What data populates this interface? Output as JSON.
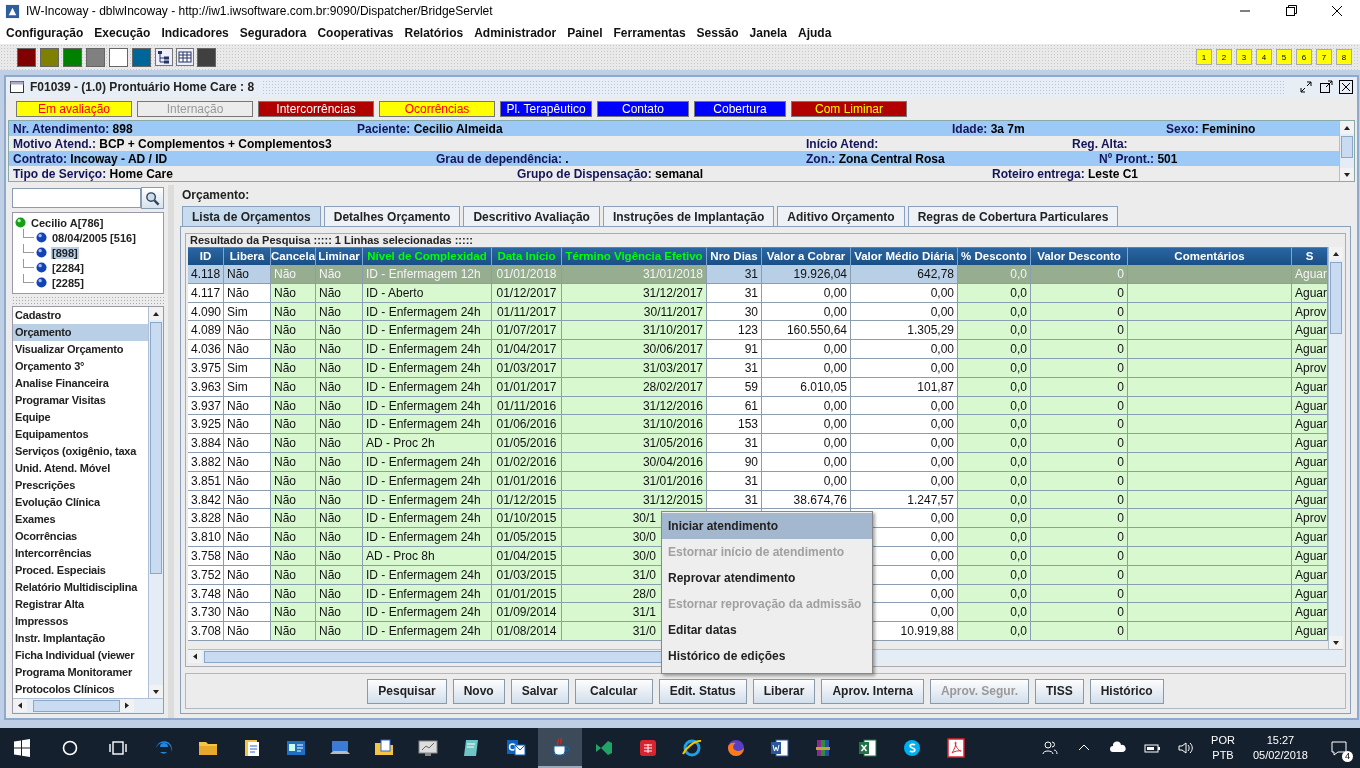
{
  "window": {
    "title": "IW-Incoway - dblwIncoway - http://iw1.iwsoftware.com.br:9090/Dispatcher/BridgeServlet"
  },
  "menu": [
    "Configuração",
    "Execução",
    "Indicadores",
    "Seguradora",
    "Cooperativas",
    "Relatórios",
    "Administrador",
    "Painel",
    "Ferramentas",
    "Sessão",
    "Janela",
    "Ajuda"
  ],
  "toolbar": [
    {
      "kind": "swatch",
      "color": "#800000"
    },
    {
      "kind": "swatch",
      "color": "#808000"
    },
    {
      "kind": "swatch",
      "color": "#008000"
    },
    {
      "kind": "swatch",
      "color": "#808080"
    },
    {
      "kind": "swatch",
      "color": "#ffffff"
    },
    {
      "kind": "swatch",
      "color": "#006699"
    },
    {
      "kind": "tree"
    },
    {
      "kind": "grid"
    },
    {
      "kind": "swatch",
      "color": "#404040"
    }
  ],
  "quick_buttons": [
    "1",
    "2",
    "3",
    "4",
    "5",
    "6",
    "7",
    "8"
  ],
  "frame": {
    "title": "F01039 - (1.0) Prontuário Home Care : 8"
  },
  "status_tabs": [
    {
      "label": "Em avaliação",
      "color": "#ffff00"
    },
    {
      "label": "Internação",
      "color": "#ececec"
    },
    {
      "label": "Intercorrências",
      "color": "#b00000"
    },
    {
      "label": "Ocorrências",
      "color": "#ffff00"
    },
    {
      "label": "Pl. Terapêutico",
      "color": "#0000ff"
    },
    {
      "label": "Contato",
      "color": "#0000ff"
    },
    {
      "label": "Cobertura",
      "color": "#0000ff"
    },
    {
      "label": "Com Liminar",
      "color": "#b00000"
    }
  ],
  "patient_info": [
    [
      {
        "label": "Nr. Atendimento:",
        "value": "898"
      },
      {
        "label": "Paciente:",
        "value": "Cecilio Almeida"
      },
      {
        "label": "Idade:",
        "value": "3a 7m"
      },
      {
        "label": "Sexo:",
        "value": "Feminino"
      }
    ],
    [
      {
        "label": "Motivo Atend.:",
        "value": "BCP + Complementos + Complementos3"
      },
      {
        "label": "Início Atend:"
      },
      {
        "label": "Reg. Alta:"
      }
    ],
    [
      {
        "label": "Contrato:",
        "value": "Incoway - AD / ID"
      },
      {
        "label": "Grau de dependência:",
        "value": "."
      },
      {
        "label": "Zon.:",
        "value": "Zona Central Rosa"
      },
      {
        "label": "Nº Pront.:",
        "value": "501"
      }
    ],
    [
      {
        "label": "Tipo de Serviço:",
        "value": "Home Care"
      },
      {
        "label": "Grupo de Dispensação:",
        "value": "semanal"
      },
      {
        "label": "Roteiro entrega:",
        "value": "Leste C1"
      }
    ]
  ],
  "patient_tree": {
    "label": "Cecilio A[786]",
    "children": [
      {
        "label": "08/04/2005 [516]",
        "selected": false
      },
      {
        "label": "[898]",
        "selected": true
      },
      {
        "label": "[2284]",
        "selected": false
      },
      {
        "label": "[2285]",
        "selected": false
      }
    ]
  },
  "nav_items": [
    {
      "label": "Cadastro",
      "selected": false
    },
    {
      "label": "Orçamento",
      "selected": true
    },
    {
      "label": "Visualizar Orçamento",
      "selected": false
    },
    {
      "label": "Orçamento 3°",
      "selected": false
    },
    {
      "label": "Analise Financeira",
      "selected": false
    },
    {
      "label": "Programar Visitas",
      "selected": false
    },
    {
      "label": "Equipe",
      "selected": false
    },
    {
      "label": "Equipamentos",
      "selected": false
    },
    {
      "label": "Serviços (oxigênio, taxa",
      "selected": false
    },
    {
      "label": "Unid. Atend. Móvel",
      "selected": false
    },
    {
      "label": "Prescrições",
      "selected": false
    },
    {
      "label": "Evolução Clínica",
      "selected": false
    },
    {
      "label": "Exames",
      "selected": false
    },
    {
      "label": "Ocorrências",
      "selected": false
    },
    {
      "label": "Intercorrências",
      "selected": false
    },
    {
      "label": "Proced. Especiais",
      "selected": false
    },
    {
      "label": "Relatório Multidisciplina",
      "selected": false
    },
    {
      "label": "Registrar Alta",
      "selected": false
    },
    {
      "label": "Impressos",
      "selected": false
    },
    {
      "label": "Instr. Implantação",
      "selected": false
    },
    {
      "label": "Ficha Individual (viewer",
      "selected": false
    },
    {
      "label": "Programa Monitoramer",
      "selected": false
    },
    {
      "label": "Protocolos Clínicos",
      "selected": false
    }
  ],
  "section_title": "Orçamento:",
  "tabs": [
    {
      "label": "Lista de Orçamentos",
      "selected": true
    },
    {
      "label": "Detalhes Orçamento",
      "selected": false
    },
    {
      "label": "Descritivo Avaliação",
      "selected": false
    },
    {
      "label": "Instruções de Implantação",
      "selected": false
    },
    {
      "label": "Aditivo Orçamento",
      "selected": false
    },
    {
      "label": "Regras de Cobertura Particulares",
      "selected": false
    }
  ],
  "result_title": "Resultado da Pesquisa ::::: 1 Linhas selecionadas :::::",
  "table": {
    "columns": [
      {
        "label": "ID",
        "highlighted": false,
        "tinted": false
      },
      {
        "label": "Libera",
        "highlighted": false,
        "tinted": false
      },
      {
        "label": "Cancela",
        "highlighted": false,
        "tinted": true
      },
      {
        "label": "Liminar",
        "highlighted": false,
        "tinted": true
      },
      {
        "label": "Nível de Complexidad",
        "highlighted": true,
        "tinted": true
      },
      {
        "label": "Data Início",
        "highlighted": true,
        "tinted": true
      },
      {
        "label": "Término Vigência Efetivo",
        "highlighted": true,
        "tinted": true
      },
      {
        "label": "Nro Dias",
        "highlighted": false,
        "tinted": false
      },
      {
        "label": "Valor a Cobrar",
        "highlighted": false,
        "tinted": false
      },
      {
        "label": "Valor Médio Diária",
        "highlighted": false,
        "tinted": false
      },
      {
        "label": "% Desconto",
        "highlighted": false,
        "tinted": true
      },
      {
        "label": "Valor Desconto",
        "highlighted": false,
        "tinted": true
      },
      {
        "label": "Comentários",
        "highlighted": false,
        "tinted": true
      },
      {
        "label": "S",
        "highlighted": false,
        "tinted": true
      }
    ],
    "rows": [
      {
        "selected": true,
        "cells": [
          "4.118",
          "Não",
          "Não",
          "Não",
          "ID - Enfermagem 12h",
          "01/01/2018",
          "31/01/2018",
          "31",
          "19.926,04",
          "642,78",
          "0,0",
          "0",
          null,
          "Aguar"
        ]
      },
      {
        "selected": false,
        "cells": [
          "4.117",
          "Não",
          "Não",
          "Não",
          "ID - Aberto",
          "01/12/2017",
          "31/12/2017",
          "31",
          "0,00",
          "0,00",
          "0,0",
          "0",
          null,
          "Aguar"
        ]
      },
      {
        "selected": false,
        "cells": [
          "4.090",
          "Sim",
          "Não",
          "Não",
          "ID - Enfermagem 24h",
          "01/11/2017",
          "30/11/2017",
          "30",
          "0,00",
          "0,00",
          "0,0",
          "0",
          null,
          "Aprov"
        ]
      },
      {
        "selected": false,
        "cells": [
          "4.089",
          "Não",
          "Não",
          "Não",
          "ID - Enfermagem 24h",
          "01/07/2017",
          "31/10/2017",
          "123",
          "160.550,64",
          "1.305,29",
          "0,0",
          "0",
          null,
          "Aguar"
        ]
      },
      {
        "selected": false,
        "cells": [
          "4.036",
          "Não",
          "Não",
          "Não",
          "ID - Enfermagem 24h",
          "01/04/2017",
          "30/06/2017",
          "91",
          "0,00",
          "0,00",
          "0,0",
          "0",
          null,
          "Aguar"
        ]
      },
      {
        "selected": false,
        "cells": [
          "3.975",
          "Sim",
          "Não",
          "Não",
          "ID - Enfermagem 24h",
          "01/03/2017",
          "31/03/2017",
          "31",
          "0,00",
          "0,00",
          "0,0",
          "0",
          null,
          "Aprov"
        ]
      },
      {
        "selected": false,
        "cells": [
          "3.963",
          "Sim",
          "Não",
          "Não",
          "ID - Enfermagem 24h",
          "01/01/2017",
          "28/02/2017",
          "59",
          "6.010,05",
          "101,87",
          "0,0",
          "0",
          null,
          "Aguar"
        ]
      },
      {
        "selected": false,
        "cells": [
          "3.937",
          "Não",
          "Não",
          "Não",
          "ID - Enfermagem 24h",
          "01/11/2016",
          "31/12/2016",
          "61",
          "0,00",
          "0,00",
          "0,0",
          "0",
          null,
          "Aguar"
        ]
      },
      {
        "selected": false,
        "cells": [
          "3.925",
          "Não",
          "Não",
          "Não",
          "ID - Enfermagem 24h",
          "01/06/2016",
          "31/10/2016",
          "153",
          "0,00",
          "0,00",
          "0,0",
          "0",
          null,
          "Aguar"
        ]
      },
      {
        "selected": false,
        "cells": [
          "3.884",
          "Não",
          "Não",
          "Não",
          "AD - Proc 2h",
          "01/05/2016",
          "31/05/2016",
          "31",
          "0,00",
          "0,00",
          "0,0",
          "0",
          null,
          "Aguar"
        ]
      },
      {
        "selected": false,
        "cells": [
          "3.882",
          "Não",
          "Não",
          "Não",
          "ID - Enfermagem 24h",
          "01/02/2016",
          "30/04/2016",
          "90",
          "0,00",
          "0,00",
          "0,0",
          "0",
          null,
          "Aguar"
        ]
      },
      {
        "selected": false,
        "cells": [
          "3.851",
          "Não",
          "Não",
          "Não",
          "ID - Enfermagem 24h",
          "01/01/2016",
          "31/01/2016",
          "31",
          "0,00",
          "0,00",
          "0,0",
          "0",
          null,
          "Aguar"
        ]
      },
      {
        "selected": false,
        "cells": [
          "3.842",
          "Não",
          "Não",
          "Não",
          "ID - Enfermagem 24h",
          "01/12/2015",
          "31/12/2015",
          "31",
          "38.674,76",
          "1.247,57",
          "0,0",
          "0",
          null,
          "Aguar"
        ]
      },
      {
        "selected": false,
        "cells": [
          "3.828",
          "Não",
          "Não",
          "Não",
          "ID - Enfermagem 24h",
          "01/10/2015",
          "30/1",
          null,
          null,
          "0,00",
          "0,0",
          "0",
          null,
          "Aprov"
        ]
      },
      {
        "selected": false,
        "cells": [
          "3.810",
          "Não",
          "Não",
          "Não",
          "ID - Enfermagem 24h",
          "01/05/2015",
          "30/0",
          null,
          null,
          "0,00",
          "0,0",
          "0",
          null,
          "Aguar"
        ]
      },
      {
        "selected": false,
        "cells": [
          "3.758",
          "Não",
          "Não",
          "Não",
          "AD - Proc 8h",
          "01/04/2015",
          "30/0",
          null,
          null,
          "0,00",
          "0,0",
          "0",
          null,
          "Aguar"
        ]
      },
      {
        "selected": false,
        "cells": [
          "3.752",
          "Não",
          "Não",
          "Não",
          "ID - Enfermagem 24h",
          "01/03/2015",
          "31/0",
          null,
          null,
          "0,00",
          "0,0",
          "0",
          null,
          "Aguar"
        ]
      },
      {
        "selected": false,
        "cells": [
          "3.748",
          "Não",
          "Não",
          "Não",
          "ID - Enfermagem 24h",
          "01/01/2015",
          "28/0",
          null,
          null,
          "0,00",
          "0,0",
          "0",
          null,
          "Aguar"
        ]
      },
      {
        "selected": false,
        "cells": [
          "3.730",
          "Não",
          "Não",
          "Não",
          "ID - Enfermagem 24h",
          "01/09/2014",
          "31/1",
          null,
          null,
          "0,00",
          "0,0",
          "0",
          null,
          "Aguar"
        ]
      },
      {
        "selected": false,
        "cells": [
          "3.708",
          "Não",
          "Não",
          "Não",
          "ID - Enfermagem 24h",
          "01/08/2014",
          "31/0",
          null,
          null,
          "10.919,88",
          "0,0",
          "0",
          null,
          "Aguar"
        ]
      }
    ]
  },
  "context_menu": [
    {
      "label": "Iniciar atendimento",
      "selected": true,
      "disabled": false
    },
    {
      "label": "Estornar início de atendimento",
      "selected": false,
      "disabled": true
    },
    {
      "label": "Reprovar atendimento",
      "selected": false,
      "disabled": false
    },
    {
      "label": "Estornar reprovação da admissão",
      "selected": false,
      "disabled": true
    },
    {
      "label": "Editar datas",
      "selected": false,
      "disabled": false
    },
    {
      "label": "Histórico de edições",
      "selected": false,
      "disabled": false
    }
  ],
  "buttons": [
    {
      "label": "Pesquisar",
      "disabled": false
    },
    {
      "label": "Novo",
      "disabled": false
    },
    {
      "label": "Salvar",
      "disabled": false
    },
    {
      "label": "Calcular",
      "disabled": false
    },
    {
      "label": "Edit. Status",
      "disabled": false
    },
    {
      "label": "Liberar",
      "disabled": false
    },
    {
      "label": "Aprov. Interna",
      "disabled": false
    },
    {
      "label": "Aprov. Segur.",
      "disabled": true
    },
    {
      "label": "TISS",
      "disabled": false
    },
    {
      "label": "Histórico",
      "disabled": false
    }
  ],
  "taskbar": {
    "apps": [
      {
        "kind": "e-browser",
        "active": false
      },
      {
        "kind": "folder",
        "active": false
      },
      {
        "kind": "clipboard",
        "active": false
      },
      {
        "kind": "card",
        "active": false
      },
      {
        "kind": "computer",
        "active": false
      },
      {
        "kind": "folder-doc",
        "active": false
      },
      {
        "kind": "monitor",
        "active": false
      },
      {
        "kind": "notepad",
        "active": false
      },
      {
        "kind": "mail",
        "active": false
      },
      {
        "kind": "cup",
        "active": true
      },
      {
        "kind": "infinity",
        "active": false
      },
      {
        "kind": "shield",
        "active": false
      },
      {
        "kind": "globe",
        "active": false
      },
      {
        "kind": "fox",
        "active": false
      },
      {
        "kind": "word-doc",
        "active": false
      },
      {
        "kind": "stack",
        "active": false
      },
      {
        "kind": "sheet",
        "active": false
      },
      {
        "kind": "chat",
        "active": false
      },
      {
        "kind": "pdf",
        "active": false
      }
    ],
    "language": [
      "POR",
      "PTB"
    ],
    "time": "15:27",
    "date": "05/02/2018",
    "notifications": "4"
  }
}
